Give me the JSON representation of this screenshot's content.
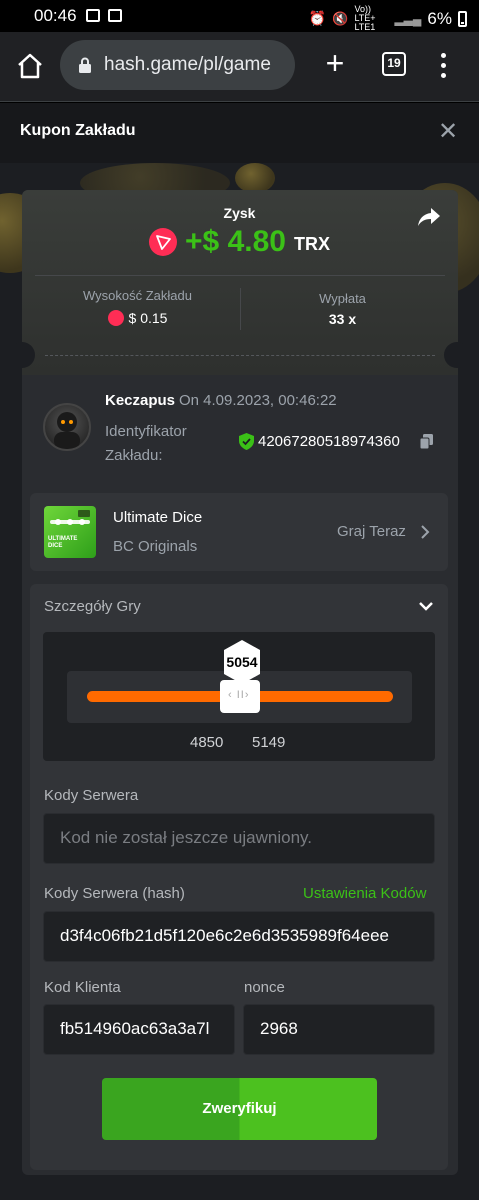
{
  "status_bar": {
    "time": "00:46",
    "network": "Vo)) LTE+ LTE1",
    "battery": "6%"
  },
  "browser": {
    "url": "hash.game/pl/game",
    "tab_count": "19"
  },
  "modal": {
    "title": "Kupon Zakładu"
  },
  "bet": {
    "profit_label": "Zysk",
    "profit_amount": "+$ 4.80",
    "profit_currency": "TRX",
    "amount_label": "Wysokość Zakładu",
    "amount_value": "$ 0.15",
    "payout_label": "Wypłata",
    "payout_value": "33 x"
  },
  "user": {
    "name": "Keczapus",
    "date": "On 4.09.2023, 00:46:22",
    "bet_id_label": "Identyfikator Zakładu:",
    "bet_id": "42067280518974360"
  },
  "game": {
    "name": "Ultimate Dice",
    "provider": "BC Originals",
    "play_label": "Graj Teraz",
    "thumb_text": "ULTIMATE DICE"
  },
  "details": {
    "title": "Szczegóły Gry",
    "result": "5054",
    "range_low": "4850",
    "range_high": "5149",
    "server_seed_label": "Kody Serwera",
    "server_seed_placeholder": "Kod nie został jeszcze ujawniony.",
    "server_hash_label": "Kody Serwera (hash)",
    "seed_settings_link": "Ustawienia Kodów",
    "server_hash_value": "d3f4c06fb21d5f120e6c2e6d3535989f64eee",
    "client_seed_label": "Kod Klienta",
    "client_seed_value": "fb514960ac63a3a7l",
    "nonce_label": "nonce",
    "nonce_value": "2968",
    "verify_label": "Zweryfikuj"
  },
  "colors": {
    "accent_green": "#3bc117",
    "track_orange": "#ff6a00",
    "trx_red": "#ff2d55"
  }
}
